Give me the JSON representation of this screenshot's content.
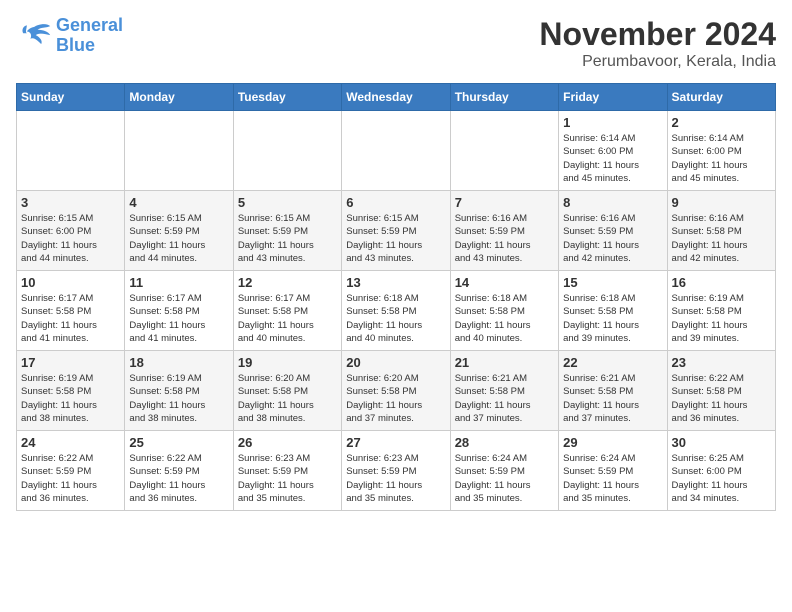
{
  "logo": {
    "line1": "General",
    "line2": "Blue"
  },
  "title": "November 2024",
  "location": "Perumbavoor, Kerala, India",
  "weekdays": [
    "Sunday",
    "Monday",
    "Tuesday",
    "Wednesday",
    "Thursday",
    "Friday",
    "Saturday"
  ],
  "weeks": [
    [
      {
        "day": "",
        "info": ""
      },
      {
        "day": "",
        "info": ""
      },
      {
        "day": "",
        "info": ""
      },
      {
        "day": "",
        "info": ""
      },
      {
        "day": "",
        "info": ""
      },
      {
        "day": "1",
        "info": "Sunrise: 6:14 AM\nSunset: 6:00 PM\nDaylight: 11 hours\nand 45 minutes."
      },
      {
        "day": "2",
        "info": "Sunrise: 6:14 AM\nSunset: 6:00 PM\nDaylight: 11 hours\nand 45 minutes."
      }
    ],
    [
      {
        "day": "3",
        "info": "Sunrise: 6:15 AM\nSunset: 6:00 PM\nDaylight: 11 hours\nand 44 minutes."
      },
      {
        "day": "4",
        "info": "Sunrise: 6:15 AM\nSunset: 5:59 PM\nDaylight: 11 hours\nand 44 minutes."
      },
      {
        "day": "5",
        "info": "Sunrise: 6:15 AM\nSunset: 5:59 PM\nDaylight: 11 hours\nand 43 minutes."
      },
      {
        "day": "6",
        "info": "Sunrise: 6:15 AM\nSunset: 5:59 PM\nDaylight: 11 hours\nand 43 minutes."
      },
      {
        "day": "7",
        "info": "Sunrise: 6:16 AM\nSunset: 5:59 PM\nDaylight: 11 hours\nand 43 minutes."
      },
      {
        "day": "8",
        "info": "Sunrise: 6:16 AM\nSunset: 5:59 PM\nDaylight: 11 hours\nand 42 minutes."
      },
      {
        "day": "9",
        "info": "Sunrise: 6:16 AM\nSunset: 5:58 PM\nDaylight: 11 hours\nand 42 minutes."
      }
    ],
    [
      {
        "day": "10",
        "info": "Sunrise: 6:17 AM\nSunset: 5:58 PM\nDaylight: 11 hours\nand 41 minutes."
      },
      {
        "day": "11",
        "info": "Sunrise: 6:17 AM\nSunset: 5:58 PM\nDaylight: 11 hours\nand 41 minutes."
      },
      {
        "day": "12",
        "info": "Sunrise: 6:17 AM\nSunset: 5:58 PM\nDaylight: 11 hours\nand 40 minutes."
      },
      {
        "day": "13",
        "info": "Sunrise: 6:18 AM\nSunset: 5:58 PM\nDaylight: 11 hours\nand 40 minutes."
      },
      {
        "day": "14",
        "info": "Sunrise: 6:18 AM\nSunset: 5:58 PM\nDaylight: 11 hours\nand 40 minutes."
      },
      {
        "day": "15",
        "info": "Sunrise: 6:18 AM\nSunset: 5:58 PM\nDaylight: 11 hours\nand 39 minutes."
      },
      {
        "day": "16",
        "info": "Sunrise: 6:19 AM\nSunset: 5:58 PM\nDaylight: 11 hours\nand 39 minutes."
      }
    ],
    [
      {
        "day": "17",
        "info": "Sunrise: 6:19 AM\nSunset: 5:58 PM\nDaylight: 11 hours\nand 38 minutes."
      },
      {
        "day": "18",
        "info": "Sunrise: 6:19 AM\nSunset: 5:58 PM\nDaylight: 11 hours\nand 38 minutes."
      },
      {
        "day": "19",
        "info": "Sunrise: 6:20 AM\nSunset: 5:58 PM\nDaylight: 11 hours\nand 38 minutes."
      },
      {
        "day": "20",
        "info": "Sunrise: 6:20 AM\nSunset: 5:58 PM\nDaylight: 11 hours\nand 37 minutes."
      },
      {
        "day": "21",
        "info": "Sunrise: 6:21 AM\nSunset: 5:58 PM\nDaylight: 11 hours\nand 37 minutes."
      },
      {
        "day": "22",
        "info": "Sunrise: 6:21 AM\nSunset: 5:58 PM\nDaylight: 11 hours\nand 37 minutes."
      },
      {
        "day": "23",
        "info": "Sunrise: 6:22 AM\nSunset: 5:58 PM\nDaylight: 11 hours\nand 36 minutes."
      }
    ],
    [
      {
        "day": "24",
        "info": "Sunrise: 6:22 AM\nSunset: 5:59 PM\nDaylight: 11 hours\nand 36 minutes."
      },
      {
        "day": "25",
        "info": "Sunrise: 6:22 AM\nSunset: 5:59 PM\nDaylight: 11 hours\nand 36 minutes."
      },
      {
        "day": "26",
        "info": "Sunrise: 6:23 AM\nSunset: 5:59 PM\nDaylight: 11 hours\nand 35 minutes."
      },
      {
        "day": "27",
        "info": "Sunrise: 6:23 AM\nSunset: 5:59 PM\nDaylight: 11 hours\nand 35 minutes."
      },
      {
        "day": "28",
        "info": "Sunrise: 6:24 AM\nSunset: 5:59 PM\nDaylight: 11 hours\nand 35 minutes."
      },
      {
        "day": "29",
        "info": "Sunrise: 6:24 AM\nSunset: 5:59 PM\nDaylight: 11 hours\nand 35 minutes."
      },
      {
        "day": "30",
        "info": "Sunrise: 6:25 AM\nSunset: 6:00 PM\nDaylight: 11 hours\nand 34 minutes."
      }
    ]
  ]
}
